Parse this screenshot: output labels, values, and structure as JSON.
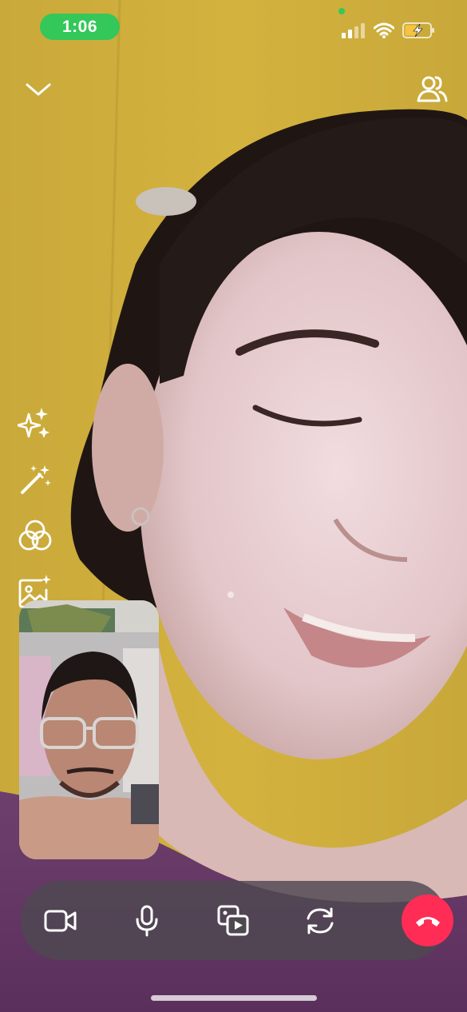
{
  "status_bar": {
    "time": "1:06",
    "icons": [
      "signal-icon",
      "wifi-icon",
      "battery-charging-icon"
    ],
    "pill_color": "#34c759"
  },
  "top_bar": {
    "icons": [
      "chevron-down-icon",
      "participants-icon"
    ]
  },
  "side_tools": {
    "icons": [
      "sparkles-icon",
      "magic-wand-icon",
      "filters-icon",
      "background-image-icon"
    ]
  },
  "controls": {
    "icons": [
      "camera-icon",
      "microphone-icon",
      "share-media-icon",
      "flip-camera-icon",
      "end-call-icon"
    ],
    "end_call_color": "#ff2d55"
  }
}
